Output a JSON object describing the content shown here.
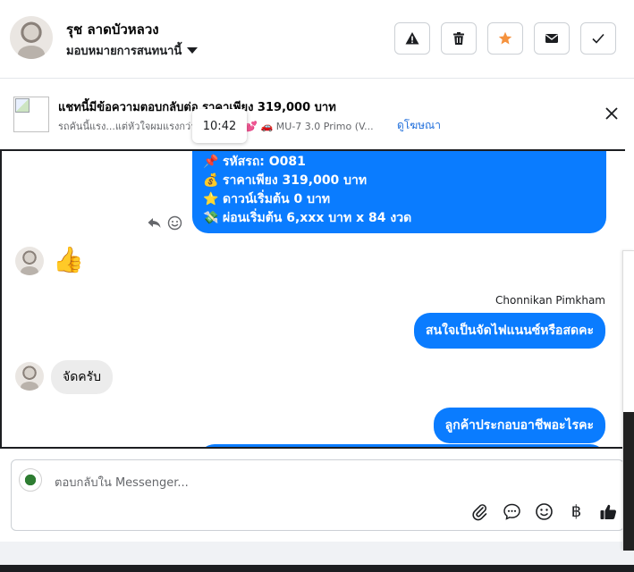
{
  "header": {
    "name": "รุช ลาดบัวหลวง",
    "assign_label": "มอบหมายการสนทนานี้"
  },
  "ad": {
    "title": "แชทนี้มีข้อความตอบกลับต่อ ราคาเพียง 319,000 บาท",
    "desc": "รถคันนี้แรง...แต่หัวใจผมแรงกว่า",
    "desc_tail": "🚗 MU-7 3.0 Primo (V...",
    "view_ad": "ดูโฆษณา",
    "tooltip_time": "10:42"
  },
  "thread": {
    "car_lines": [
      {
        "emoji": "📌",
        "text": "รหัสรถ: O081"
      },
      {
        "emoji": "💰",
        "text": "ราคาเพียง 319,000 บาท"
      },
      {
        "emoji": "⭐",
        "text": "ดาวน์เริ่มต้น 0 บาท"
      },
      {
        "emoji": "💸",
        "text": "ผ่อนเริ่มต้น 6,xxx บาท x 84 งวด"
      }
    ],
    "thumbs_up": "👍",
    "sender_name": "Chonnikan Pimkham",
    "msg_out_1": "สนใจเป็นจัดไฟแนนซ์หรือสดคะ",
    "msg_in_1": "จัดครับ",
    "msg_out_2": "ลูกค้าประกอบอาชีพอะไรคะ"
  },
  "composer": {
    "placeholder": "ตอบกลับใน Messenger...",
    "baht_symbol": "฿"
  }
}
